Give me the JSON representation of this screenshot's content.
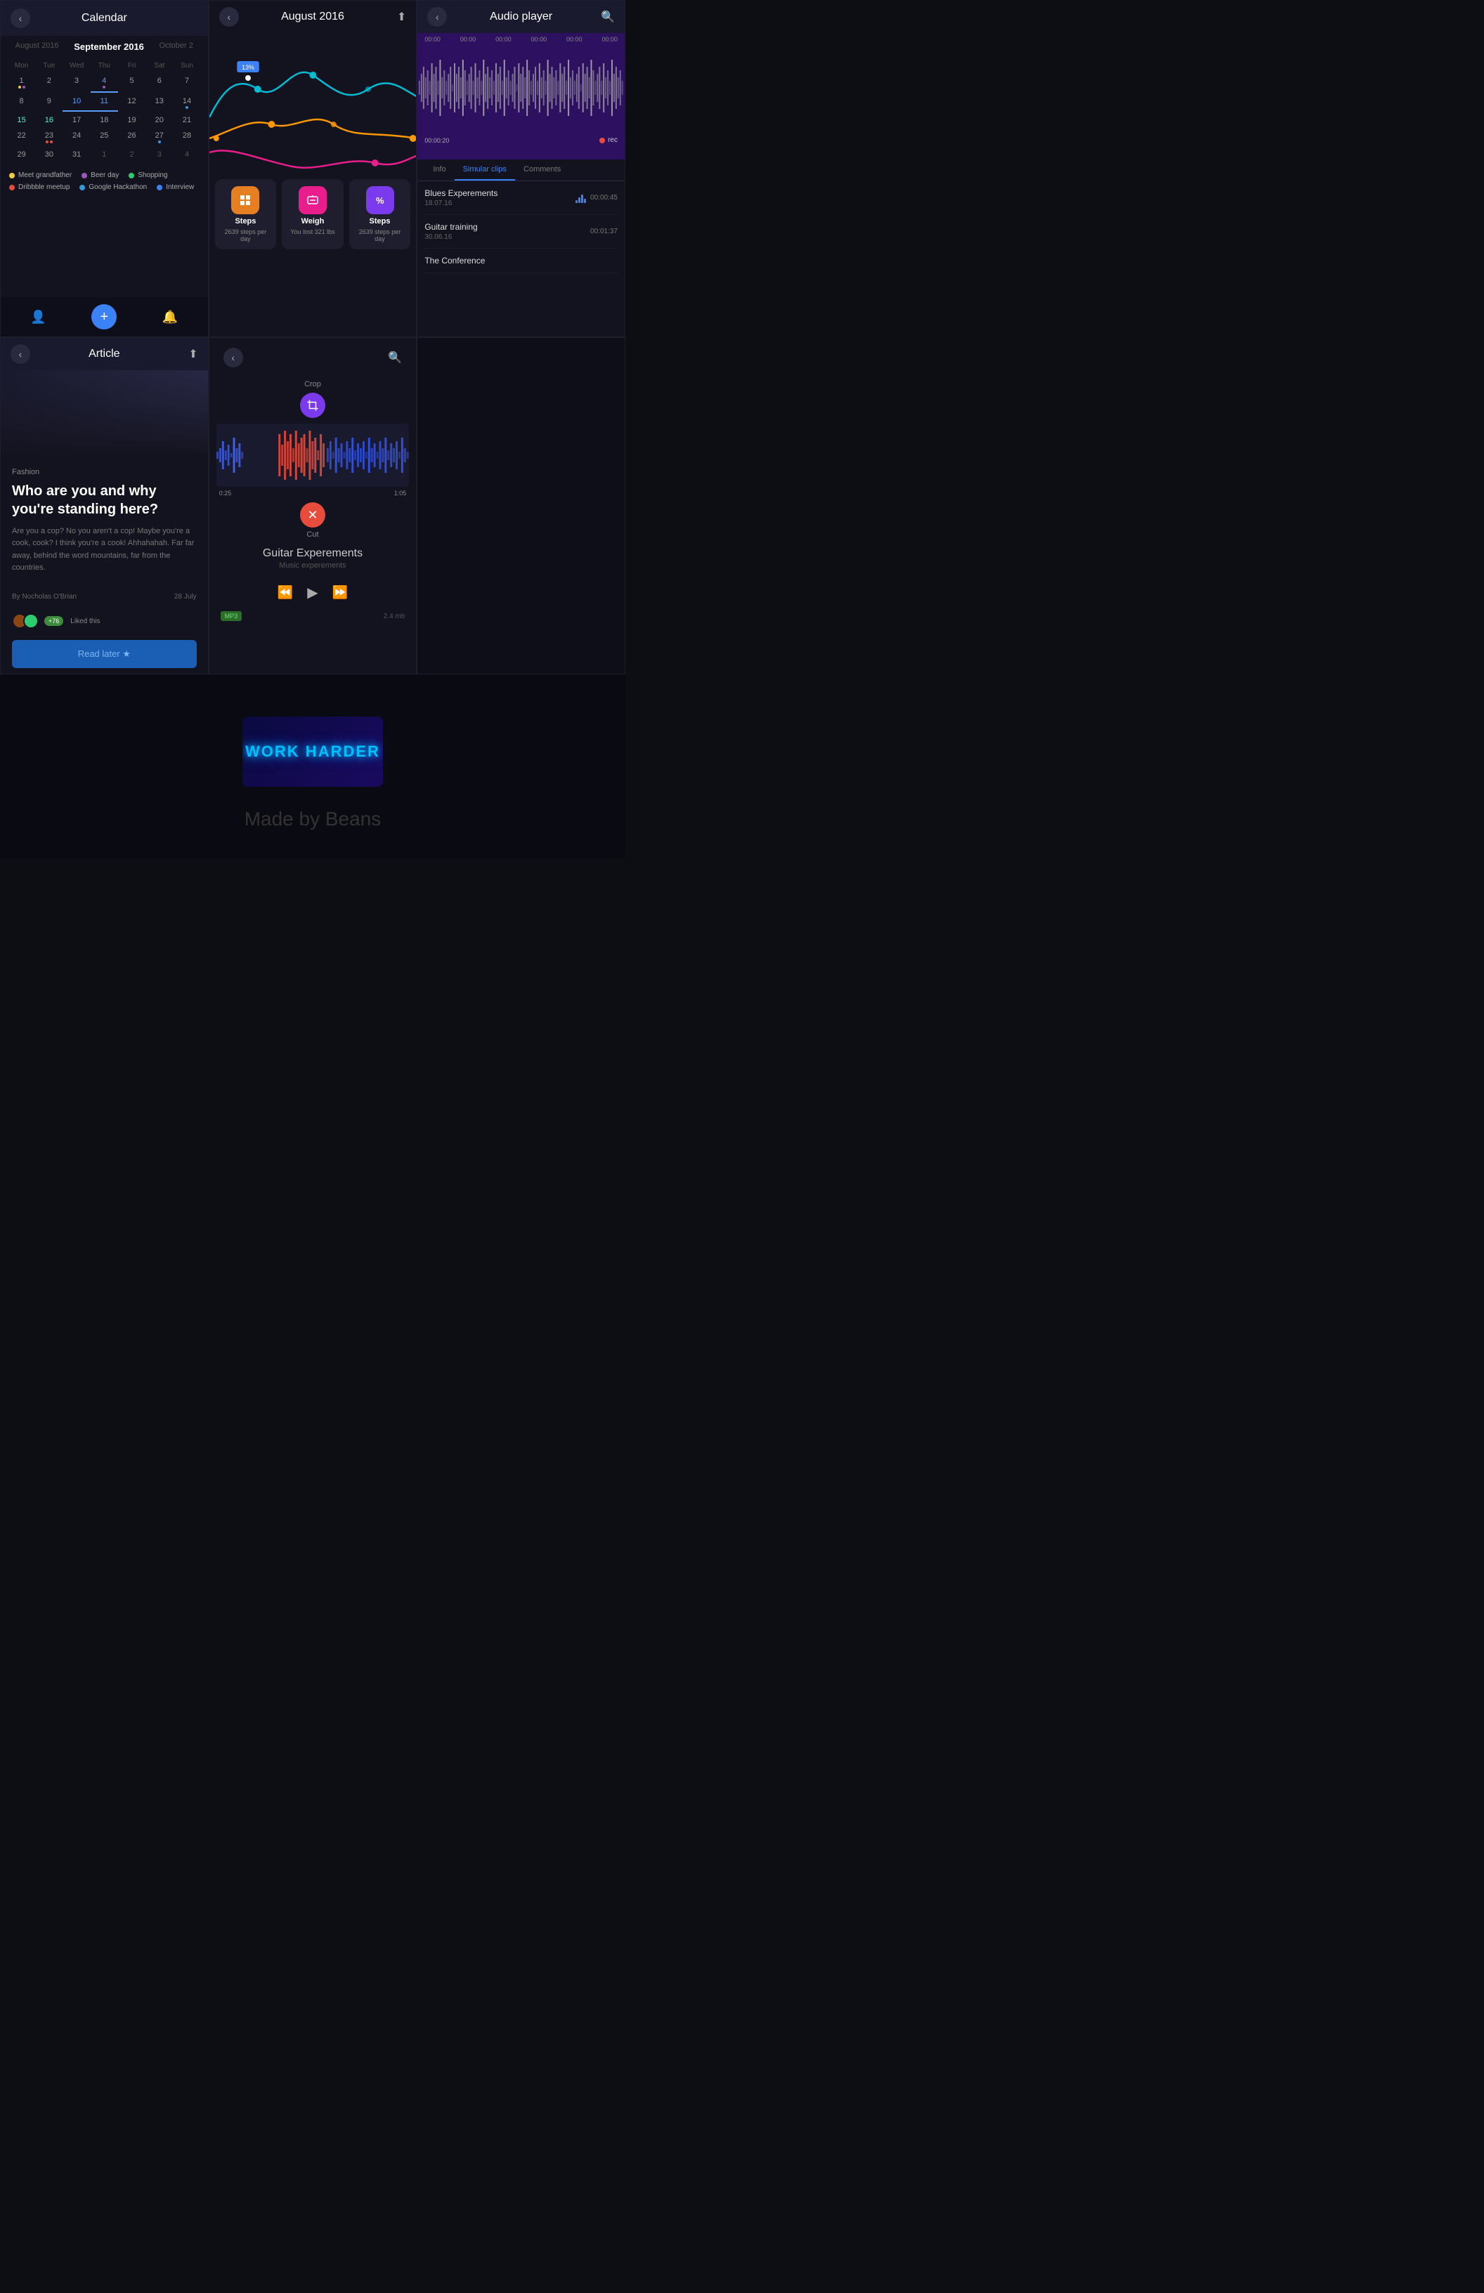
{
  "panels": {
    "calendar": {
      "title": "Calendar",
      "months": [
        "August 2016",
        "September 2016",
        "October 2"
      ],
      "days_header": [
        "Mon",
        "Tue",
        "Wed",
        "Thu",
        "Fri",
        "Sat",
        "Sun"
      ],
      "weeks": [
        [
          "1",
          "2",
          "3",
          "4",
          "5",
          "6",
          "7"
        ],
        [
          "8",
          "9",
          "10",
          "11",
          "12",
          "13",
          "14"
        ],
        [
          "15",
          "16",
          "17",
          "18",
          "19",
          "20",
          "21"
        ],
        [
          "22",
          "23",
          "24",
          "25",
          "26",
          "27",
          "28"
        ],
        [
          "29",
          "30",
          "31",
          "1",
          "2",
          "3",
          "4"
        ]
      ],
      "legend": [
        {
          "label": "Meet grandfather",
          "color": "#f5c842"
        },
        {
          "label": "Beer day",
          "color": "#9b59b6"
        },
        {
          "label": "Shopping",
          "color": "#2ecc71"
        },
        {
          "label": "Dribbble meetup",
          "color": "#e74c3c"
        },
        {
          "label": "Google Hackathon",
          "color": "#3498db"
        },
        {
          "label": "Interview",
          "color": "#3b82f6"
        }
      ]
    },
    "stats": {
      "title": "August 2016",
      "chart_label": "13%",
      "cards": [
        {
          "icon": "⊞",
          "label": "Steps",
          "sub": "2639 steps per day",
          "color": "orange"
        },
        {
          "icon": "⊠",
          "label": "Weigh",
          "sub": "You lost 321 lbs",
          "color": "pink"
        },
        {
          "icon": "%",
          "label": "Steps",
          "sub": "2639 steps per day",
          "color": "purple"
        }
      ]
    },
    "audio_player": {
      "title": "Audio player",
      "times": [
        "00:00",
        "00:00",
        "00:00",
        "00:00",
        "00:00",
        "00:00"
      ],
      "timestamp": "00:00:20",
      "rec_label": "rec",
      "tabs": [
        "Info",
        "Simular clips",
        "Comments"
      ],
      "active_tab": "Simular clips",
      "clips": [
        {
          "title": "Blues Experements",
          "date": "18.07.16",
          "duration": "00:00:45"
        },
        {
          "title": "Guitar training",
          "date": "30.06.16",
          "duration": "00:01:37"
        },
        {
          "title": "The Conference",
          "date": "",
          "duration": ""
        }
      ]
    },
    "article": {
      "title": "Article",
      "category": "Fashion",
      "heading": "Who are you and why you're standing here?",
      "body": "Are you a cop? No you aren't a cop! Maybe you're a cook, cook? I think you're a cook! Ahhahahah. Far far away, behind the word mountains, far from the countries.",
      "author": "By Nocholas O'Brian",
      "date": "28 July",
      "liked_count": "+76",
      "liked_text": "Liked this",
      "read_later": "Read later ★"
    },
    "audio_editor": {
      "crop_label": "Crop",
      "cut_label": "Cut",
      "time_start": "0:25",
      "time_end": "1:05",
      "track_title": "Guitar Experements",
      "track_subtitle": "Music experements",
      "mp3_badge": "MP3",
      "file_size": "2.4 mb"
    },
    "footer": {
      "work_harder": "WORK HARDER",
      "made_by": "Made by Beans"
    }
  }
}
